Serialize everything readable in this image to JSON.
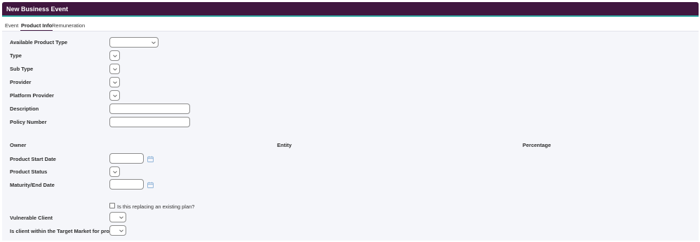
{
  "window": {
    "title": "New Business Event"
  },
  "tabs": [
    {
      "label": "Event"
    },
    {
      "label": "Product Info"
    },
    {
      "label": "Remuneration"
    }
  ],
  "form": {
    "available_product_type": {
      "label": "Available Product Type",
      "value": ""
    },
    "type": {
      "label": "Type",
      "value": ""
    },
    "sub_type": {
      "label": "Sub Type",
      "value": ""
    },
    "provider": {
      "label": "Provider",
      "value": ""
    },
    "platform_provider": {
      "label": "Platform Provider",
      "value": ""
    },
    "description": {
      "label": "Description",
      "value": ""
    },
    "policy_number": {
      "label": "Policy Number",
      "value": ""
    },
    "ownership_headers": {
      "owner": "Owner",
      "entity": "Entity",
      "percentage": "Percentage"
    },
    "product_start_date": {
      "label": "Product Start Date",
      "value": ""
    },
    "product_status": {
      "label": "Product Status",
      "value": ""
    },
    "maturity_end_date": {
      "label": "Maturity/End Date",
      "value": ""
    },
    "replacing_plan": {
      "label": "Is this replacing an existing plan?",
      "checked": false
    },
    "vulnerable_client": {
      "label": "Vulnerable Client",
      "value": ""
    },
    "target_market": {
      "label": "Is client within the Target Market for product",
      "value": ""
    }
  },
  "colors": {
    "titlebar": "#40173f",
    "accent": "#2fa7a0",
    "panel": "#f5f6fa",
    "calendar_icon": "#8fb4d8"
  }
}
